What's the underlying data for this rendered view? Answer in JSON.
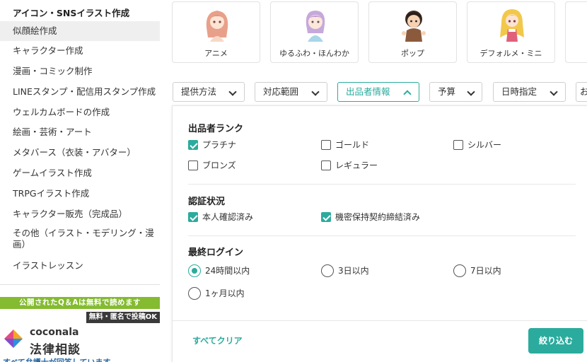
{
  "sidebar": {
    "title": "アイコン・SNSイラスト作成",
    "items": [
      {
        "label": "似顔絵作成"
      },
      {
        "label": "キャラクター作成"
      },
      {
        "label": "漫画・コミック制作"
      },
      {
        "label": "LINEスタンプ・配信用スタンプ作成"
      },
      {
        "label": "ウェルカムボードの作成"
      },
      {
        "label": "絵画・芸術・アート"
      },
      {
        "label": "メタバース（衣装・アバター）"
      },
      {
        "label": "ゲームイラスト作成"
      },
      {
        "label": "TRPGイラスト作成"
      },
      {
        "label": "キャラクター販売（完成品）"
      },
      {
        "label": "その他（イラスト・モデリング・漫画）"
      },
      {
        "label": "イラストレッスン"
      }
    ]
  },
  "ad": {
    "top_text": "公開されたQ＆Aは無料で読めます",
    "badge": "無料・匿名で投稿OK",
    "brand": "coconala",
    "service": "法律相談",
    "bottom_text": "すべて弁護士が回答しています"
  },
  "categories": [
    {
      "label": "アニメ",
      "icon": "anime-girl-illustration"
    },
    {
      "label": "ゆるふわ・ほんわか",
      "icon": "soft-girl-illustration"
    },
    {
      "label": "ポップ",
      "icon": "pop-character-illustration"
    },
    {
      "label": "デフォルメ・ミニ",
      "icon": "chibi-girl-illustration"
    }
  ],
  "filters": [
    {
      "label": "提供方法"
    },
    {
      "label": "対応範囲"
    },
    {
      "label": "出品者情報"
    },
    {
      "label": "予算"
    },
    {
      "label": "日時指定"
    },
    {
      "label": "お"
    }
  ],
  "panel": {
    "rank": {
      "title": "出品者ランク",
      "options": [
        {
          "label": "プラチナ",
          "checked": true
        },
        {
          "label": "ゴールド",
          "checked": false
        },
        {
          "label": "シルバー",
          "checked": false
        },
        {
          "label": "ブロンズ",
          "checked": false
        },
        {
          "label": "レギュラー",
          "checked": false
        }
      ]
    },
    "verify": {
      "title": "認証状況",
      "options": [
        {
          "label": "本人確認済み",
          "checked": true
        },
        {
          "label": "機密保持契約締結済み",
          "checked": true
        }
      ]
    },
    "login": {
      "title": "最終ログイン",
      "options": [
        {
          "label": "24時間以内",
          "selected": true
        },
        {
          "label": "3日以内",
          "selected": false
        },
        {
          "label": "7日以内",
          "selected": false
        },
        {
          "label": "1ヶ月以内",
          "selected": false
        }
      ]
    },
    "clear_label": "すべてクリア",
    "apply_label": "絞り込む"
  },
  "colors": {
    "accent": "#2bab9d",
    "ad_green": "#84bb30"
  }
}
